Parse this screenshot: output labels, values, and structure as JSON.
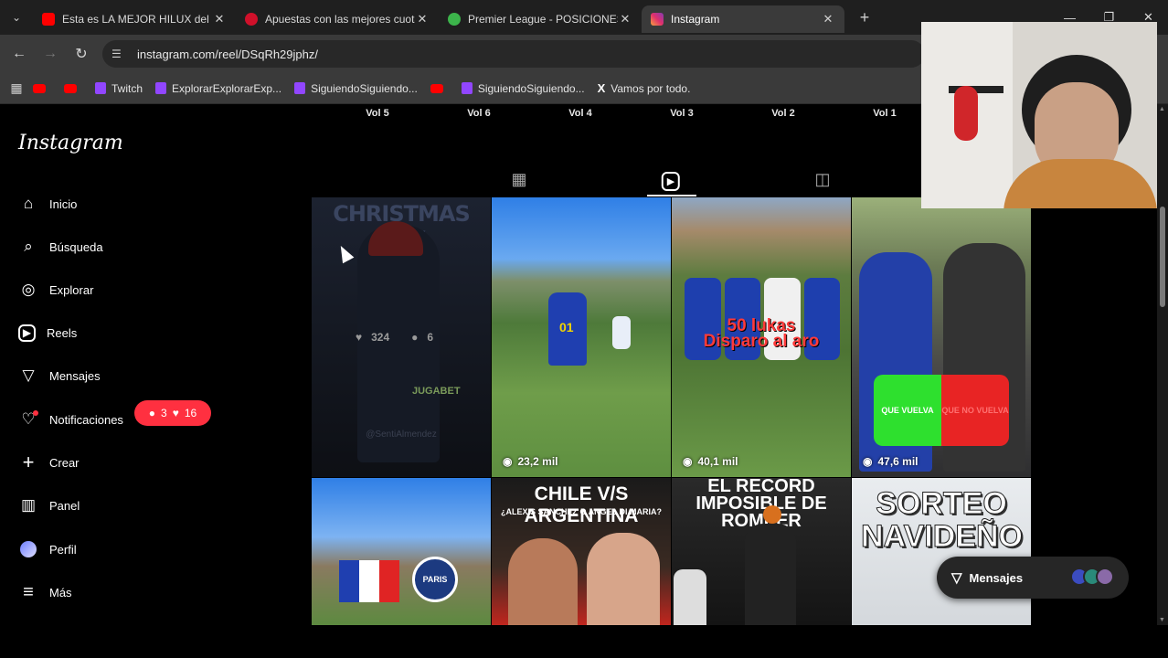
{
  "browser": {
    "tabs": [
      {
        "title": "Esta es LA MEJOR HILUX del m",
        "favicon_color": "#ff0000",
        "active": false
      },
      {
        "title": "Apuestas con las mejores cuota",
        "favicon_color": "#d0102a",
        "active": false
      },
      {
        "title": "Premier League - POSICIONES,",
        "favicon_color": "#3cb44b",
        "active": false
      },
      {
        "title": "Instagram",
        "favicon_color": "#e1306c",
        "active": true
      }
    ],
    "url": "instagram.com/reel/DSqRh29jphz/",
    "bookmarks": [
      {
        "label": "",
        "type": "youtube"
      },
      {
        "label": "",
        "type": "youtube"
      },
      {
        "label": "Twitch",
        "type": "twitch"
      },
      {
        "label": "ExplorarExplorarExp...",
        "type": "twitch"
      },
      {
        "label": "SiguiendoSiguiendo...",
        "type": "twitch"
      },
      {
        "label": "",
        "type": "youtube"
      },
      {
        "label": "SiguiendoSiguiendo...",
        "type": "twitch"
      },
      {
        "label": "Vamos por todo.",
        "type": "x"
      }
    ]
  },
  "instagram": {
    "logo": "Instagram",
    "nav": [
      {
        "label": "Inicio",
        "icon": "home-icon",
        "glyph": "⌂"
      },
      {
        "label": "Búsqueda",
        "icon": "search-icon",
        "glyph": "⌕"
      },
      {
        "label": "Explorar",
        "icon": "compass-icon",
        "glyph": "◎"
      },
      {
        "label": "Reels",
        "icon": "reels-icon",
        "glyph": "▶"
      },
      {
        "label": "Mensajes",
        "icon": "send-icon",
        "glyph": "▽"
      },
      {
        "label": "Notificaciones",
        "icon": "heart-icon",
        "glyph": "♡"
      },
      {
        "label": "Crear",
        "icon": "plus-icon",
        "glyph": "+"
      },
      {
        "label": "Panel",
        "icon": "chart-icon",
        "glyph": "▥"
      },
      {
        "label": "Perfil",
        "icon": "profile-avatar-icon",
        "glyph": "●"
      },
      {
        "label": "Más",
        "icon": "menu-icon",
        "glyph": "≡"
      }
    ],
    "notifications_badge": {
      "comments": "3",
      "likes": "16"
    },
    "highlights": [
      "Vol 5",
      "Vol 6",
      "Vol 4",
      "Vol 3",
      "Vol 2",
      "Vol 1"
    ],
    "profile_tabs": [
      {
        "name": "posts-grid-icon",
        "glyph": "▦",
        "active": false
      },
      {
        "name": "reels-tab-icon",
        "glyph": "▶",
        "active": true
      },
      {
        "name": "tagged-icon",
        "glyph": "◫",
        "active": false
      }
    ],
    "posts": [
      {
        "overlay": "CHRISTMAS DAY",
        "likes": "324",
        "comments": "6",
        "views": "",
        "hover": true,
        "watermark": "@SentiAlmendez",
        "sponsor": "JUGABET"
      },
      {
        "overlay": "",
        "views": "23,2 mil"
      },
      {
        "overlay": "50 lukas\nDisparo al aro",
        "views": "40,1 mil"
      },
      {
        "overlay": "",
        "views": "47,6 mil",
        "vote_left": "QUE VUELVA",
        "vote_right": "QUE NO VUELVA"
      },
      {
        "overlay": "",
        "views": "",
        "club": "PARIS"
      },
      {
        "overlay": "CHILE V/S ARGENTINA",
        "subtitle": "¿ALEXIS SANCHEZ O ANGEL DI MARIA?",
        "views": ""
      },
      {
        "overlay": "EL RECORD IMPOSIBLE DE ROMPER",
        "views": ""
      },
      {
        "overlay": "SORTEO NAVIDEÑO",
        "views": ""
      }
    ],
    "messages_pill": "Mensajes"
  },
  "colors": {
    "accent": "#ff3040",
    "bg": "#000000",
    "chrome": "#3a3a3a"
  }
}
